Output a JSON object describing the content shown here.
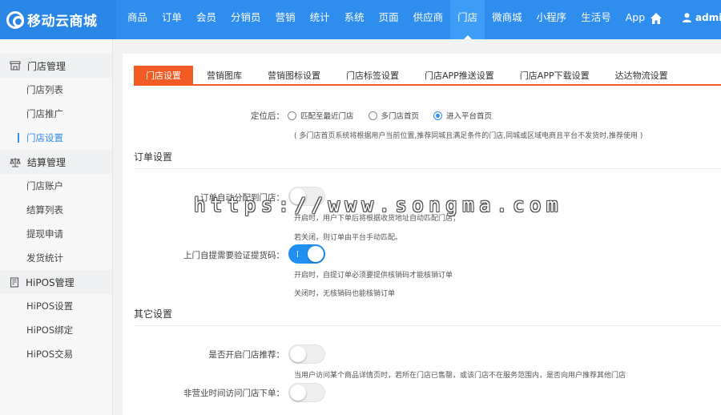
{
  "brand": {
    "name": "移动云商城"
  },
  "nav": {
    "items": [
      "商品",
      "订单",
      "会员",
      "分销员",
      "营销",
      "统计",
      "系统",
      "页面",
      "供应商",
      "门店",
      "微商城",
      "小程序",
      "生活号",
      "App"
    ],
    "active": "门店",
    "user": "admin"
  },
  "sidebar": {
    "groups": [
      {
        "label": "门店管理",
        "icon": "store-icon",
        "items": [
          "门店列表",
          "门店推广",
          "门店设置"
        ]
      },
      {
        "label": "结算管理",
        "icon": "scale-icon",
        "items": [
          "门店账户",
          "结算列表",
          "提现申请",
          "发货统计"
        ]
      },
      {
        "label": "HiPOS管理",
        "icon": "pos-icon",
        "items": [
          "HiPOS设置",
          "HiPOS绑定",
          "HiPOS交易"
        ]
      }
    ],
    "active_item": "门店设置"
  },
  "tabs": {
    "items": [
      "门店设置",
      "营销图库",
      "营销图标设置",
      "门店标签设置",
      "门店APP推送设置",
      "门店APP下载设置",
      "达达物流设置"
    ],
    "active": "门店设置"
  },
  "location": {
    "label": "定位后：",
    "options": [
      "匹配至最近门店",
      "多门店首页",
      "进入平台首页"
    ],
    "selected": "进入平台首页",
    "help": "( 多门店首页系统将根据用户当前位置,推荐同城且满足条件的门店,同城或区域电商且平台不发货时,推荐使用 )"
  },
  "order_section": {
    "title": "订单设置",
    "auto_assign": {
      "label": "订单自动分配到门店：",
      "enabled": false,
      "help_on": "开启时，用户下单后将根据收货地址自动匹配门店；",
      "help_off": "若关闭，则订单由平台手动匹配。"
    },
    "pickup_verify": {
      "label": "上门自提需要验证提货码：",
      "enabled": true,
      "help_on": "开启时，自提订单必须要提供核销码才能核销订单",
      "help_off": "关闭时，无核销码也能核销订单"
    }
  },
  "other_section": {
    "title": "其它设置",
    "recommend": {
      "label": "是否开启门店推荐：",
      "enabled": false,
      "help": "当用户访问某个商品详情页时，若所在门店已售罄，或该门店不在服务范围内，是否向用户推荐其他门店"
    },
    "off_hours": {
      "label": "非营业时间访问门店下单：",
      "enabled": false
    }
  },
  "watermark": "https://www.songma.com",
  "colors": {
    "primary": "#2e8ded",
    "tab_active": "#f15a22"
  }
}
